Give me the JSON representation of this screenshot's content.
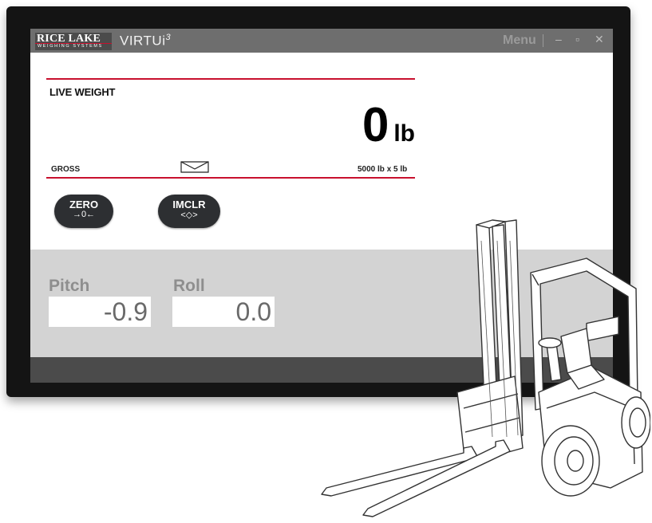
{
  "app": {
    "brand": "RICE LAKE",
    "brand_sub": "WEIGHING SYSTEMS",
    "title": "VIRTUi",
    "title_sup": "3",
    "menu_label": "Menu",
    "minimize_glyph": "–",
    "maximize_glyph": "▫",
    "close_glyph": "✕"
  },
  "scale": {
    "title": "LIVE WEIGHT",
    "value": "0",
    "unit": "lb",
    "mode": "GROSS",
    "capacity": "5000 lb x 5 lb"
  },
  "buttons": {
    "zero_label": "ZERO",
    "zero_symbol": "→0←",
    "imclr_label": "IMCLR",
    "imclr_symbol": "<◇>"
  },
  "readouts": {
    "pitch_label": "Pitch",
    "pitch_value": "-0.9",
    "roll_label": "Roll",
    "roll_value": "0.0"
  },
  "icons": {
    "zero_status": "center-of-zero-icon",
    "forklift": "forklift-illustration"
  },
  "colors": {
    "accent": "#c8102e",
    "titlebar": "#6e6e6e",
    "button": "#2d2f32",
    "panel": "#d3d3d3"
  }
}
